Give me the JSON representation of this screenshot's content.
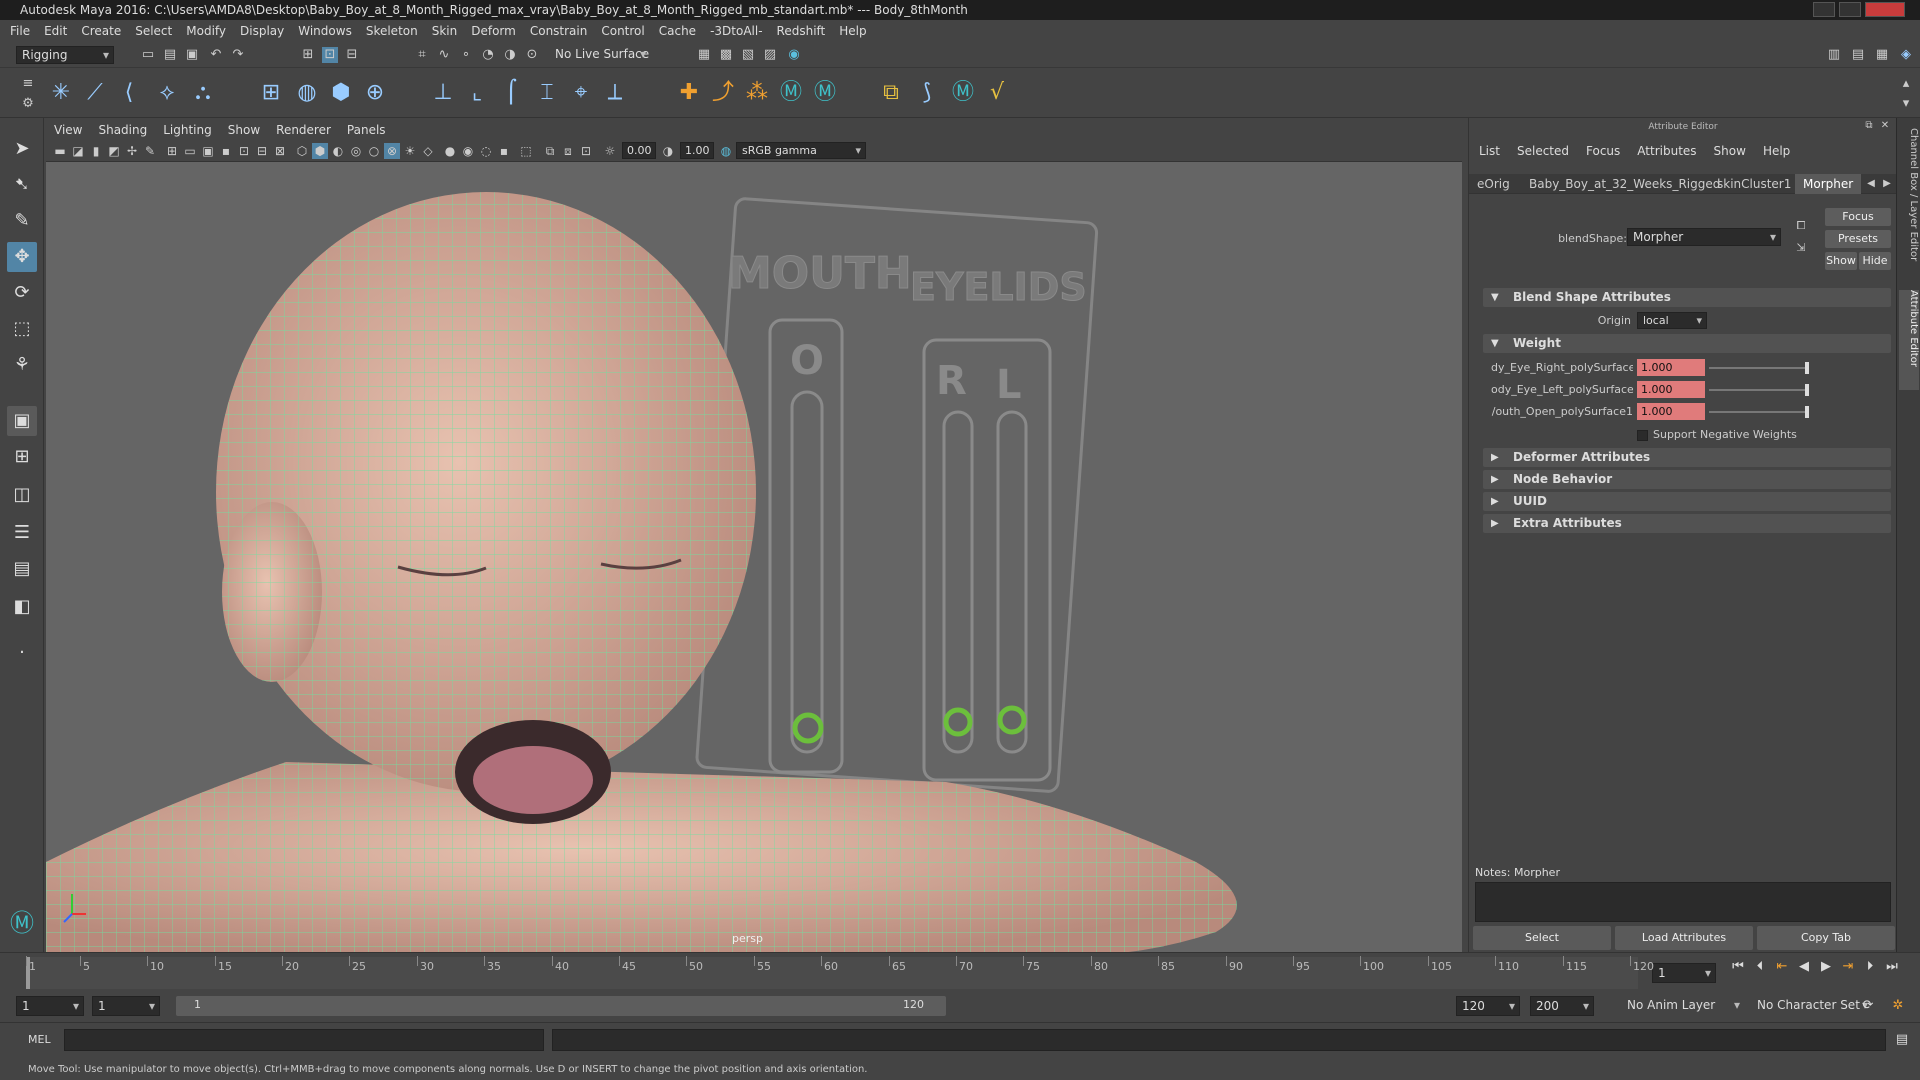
{
  "window": {
    "title": "Autodesk Maya 2016: C:\\Users\\AMDA8\\Desktop\\Baby_Boy_at_8_Month_Rigged_max_vray\\Baby_Boy_at_8_Month_Rigged_mb_standart.mb*   ---   Body_8thMonth"
  },
  "menubar": [
    "File",
    "Edit",
    "Create",
    "Select",
    "Modify",
    "Display",
    "Windows",
    "Skeleton",
    "Skin",
    "Deform",
    "Constrain",
    "Control",
    "Cache",
    "-3DtoAll-",
    "Redshift",
    "Help"
  ],
  "statusline": {
    "menuset": "Rigging",
    "live_surface": "No Live Surface"
  },
  "viewport": {
    "menu": [
      "View",
      "Shading",
      "Lighting",
      "Show",
      "Renderer",
      "Panels"
    ],
    "exposure": "0.00",
    "gamma": "1.00",
    "colorspace": "sRGB gamma",
    "camera": "persp",
    "rig_panel": {
      "mouth_title": "MOUTH",
      "eyelids_title": "EYELIDS",
      "mouth_label": "O",
      "right_label": "R",
      "left_label": "L"
    }
  },
  "attribute_editor": {
    "header": "Attribute Editor",
    "menu": [
      "List",
      "Selected",
      "Focus",
      "Attributes",
      "Show",
      "Help"
    ],
    "tabs": [
      "eOrig",
      "Baby_Boy_at_32_Weeks_Rigged",
      "skinCluster1",
      "Morpher"
    ],
    "selected_tab": "Morpher",
    "blendshape_label": "blendShape:",
    "blendshape_value": "Morpher",
    "buttons": {
      "focus": "Focus",
      "presets": "Presets",
      "show": "Show",
      "hide": "Hide"
    },
    "sections": {
      "blend_shape": "Blend Shape Attributes",
      "origin_label": "Origin",
      "origin_value": "local",
      "weight": "Weight",
      "weights": [
        {
          "label": "dy_Eye_Right_polySurface1",
          "value": "1.000"
        },
        {
          "label": "ody_Eye_Left_polySurface1",
          "value": "1.000"
        },
        {
          "label": "/outh_Open_polySurface1",
          "value": "1.000"
        }
      ],
      "support_negative": "Support Negative Weights",
      "deformer": "Deformer Attributes",
      "node_behavior": "Node Behavior",
      "uuid": "UUID",
      "extra": "Extra Attributes"
    },
    "notes_label": "Notes:  Morpher",
    "bottom_buttons": {
      "select": "Select",
      "load": "Load Attributes",
      "copy": "Copy Tab"
    }
  },
  "right_tabs": {
    "channel_box": "Channel Box / Layer Editor",
    "attribute_editor": "Attribute Editor"
  },
  "timeslider": {
    "ticks": [
      "1",
      "5",
      "10",
      "15",
      "20",
      "25",
      "30",
      "35",
      "40",
      "45",
      "50",
      "55",
      "60",
      "65",
      "70",
      "75",
      "80",
      "85",
      "90",
      "95",
      "100",
      "105",
      "110",
      "115",
      "120"
    ],
    "current_frame": "1"
  },
  "range": {
    "start": "1",
    "inner_start": "1",
    "range_start_label": "1",
    "range_end_label": "120",
    "end": "120",
    "anim_end": "200",
    "anim_layer": "No Anim Layer",
    "character_set": "No Character Set"
  },
  "cmdline": {
    "label": "MEL"
  },
  "helpline": "Move Tool: Use manipulator to move object(s). Ctrl+MMB+drag to move components along normals. Use D or INSERT to change the pivot position and axis orientation."
}
